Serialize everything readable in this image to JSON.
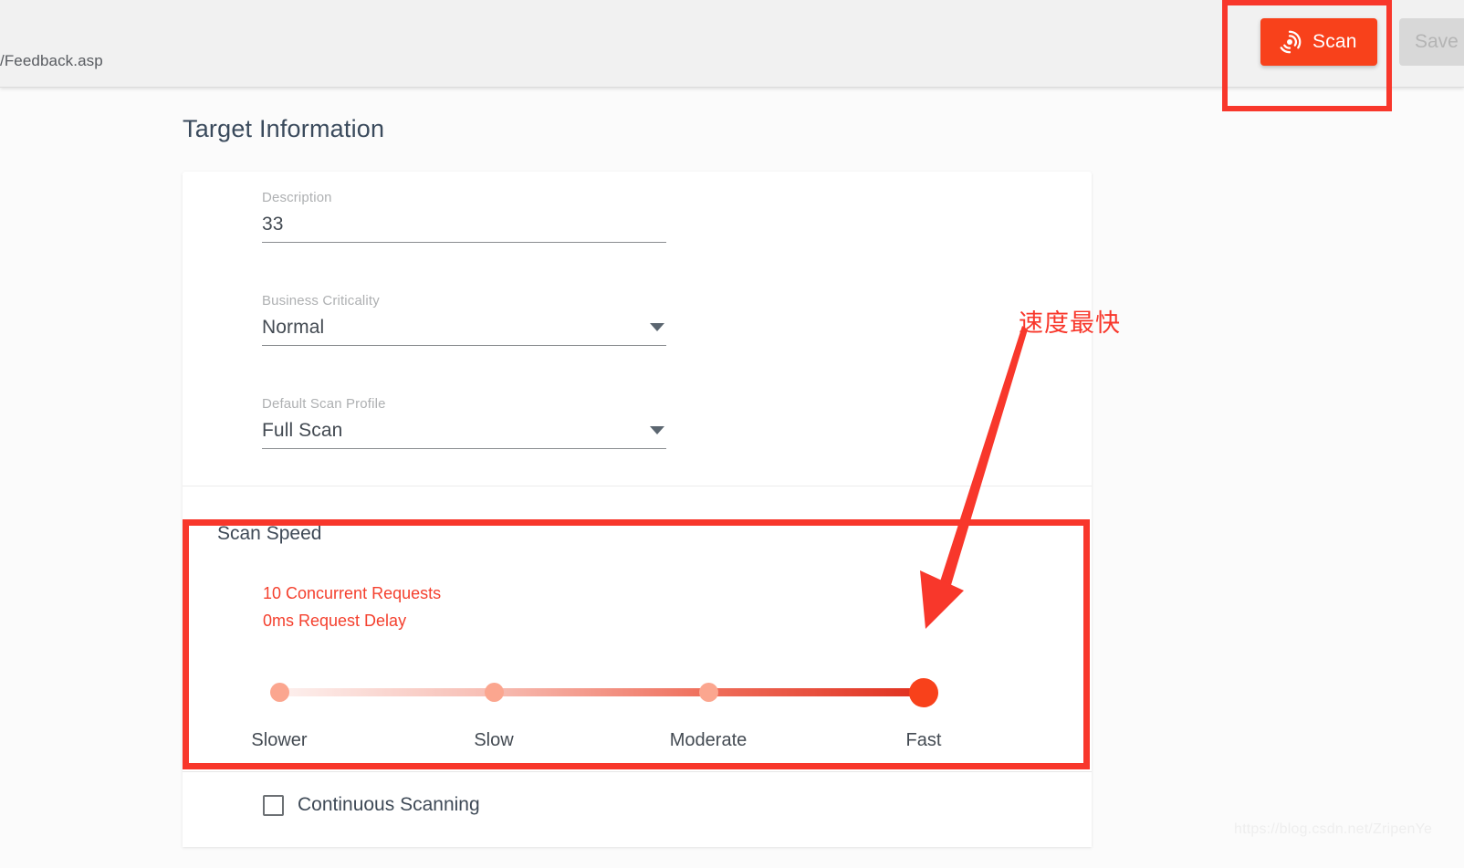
{
  "header": {
    "url_text": "/Feedback.asp",
    "scan_button_label": "Scan",
    "scan_button_icon": "radar-scan-icon",
    "scan_button_color": "#f8411b",
    "save_button_label": "Save",
    "save_button_color": "#d8d8d8"
  },
  "page": {
    "title": "Target Information"
  },
  "form": {
    "description": {
      "label": "Description",
      "value": "33",
      "placeholder": ""
    },
    "business_criticality": {
      "label": "Business Criticality",
      "value": "Normal",
      "options": [
        "Normal"
      ]
    },
    "default_scan_profile": {
      "label": "Default Scan Profile",
      "value": "Full Scan",
      "options": [
        "Full Scan"
      ]
    }
  },
  "scan_speed": {
    "section_title": "Scan Speed",
    "concurrent_requests": "10 Concurrent Requests",
    "request_delay": "0ms Request Delay",
    "info_color": "#f4402e",
    "levels": [
      "Slower",
      "Slow",
      "Moderate",
      "Fast"
    ],
    "selected_level": "Fast",
    "selected_index": 3,
    "track_gradient_from": "#fdf0ee",
    "track_gradient_to": "#e0301f",
    "thumb_color": "#f8411b",
    "tick_color": "#fba68f"
  },
  "continuous_scanning": {
    "label": "Continuous Scanning",
    "checked": false
  },
  "annotations": {
    "chinese_note": "速度最快",
    "note_color": "#f8372b",
    "box_color": "#f8372b",
    "arrow_icon": "down-left-arrow-icon",
    "scan_box_name": "scan-button-highlight",
    "speed_box_name": "scan-speed-highlight"
  },
  "watermark": {
    "text": "https://blog.csdn.net/ZripenYe"
  }
}
